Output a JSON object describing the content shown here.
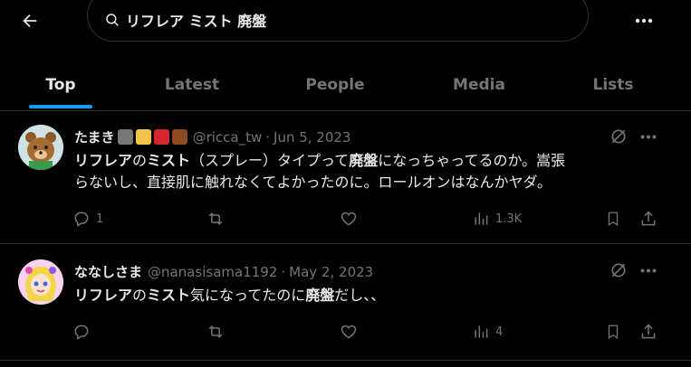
{
  "header": {
    "search_query": "リフレア ミスト 廃盤"
  },
  "tabs": [
    {
      "label": "Top"
    },
    {
      "label": "Latest"
    },
    {
      "label": "People"
    },
    {
      "label": "Media"
    },
    {
      "label": "Lists"
    }
  ],
  "tweets": [
    {
      "display_name": "たまき",
      "handle": "@ricca_tw",
      "separator": "·",
      "date": "Jun 5, 2023",
      "text_segments": [
        "リフレア",
        "の",
        "ミスト",
        "（スプレー）タイプって",
        "廃盤",
        "になっちゃってるのか。嵩張"
      ],
      "text_line2": "らないし、直接肌に触れなくてよかったのに。ロールオンはなんかヤダ。",
      "replies": "1",
      "retweets": "",
      "likes": "",
      "views": "1.3K"
    },
    {
      "display_name": "ななしさま",
      "handle": "@nanasisama1192",
      "separator": "·",
      "date": "May 2, 2023",
      "text_segments": [
        "リフレア",
        "の",
        "ミスト",
        "気になってたのに",
        "廃盤",
        "だし、、"
      ],
      "replies": "",
      "retweets": "",
      "likes": "",
      "views": "4"
    }
  ],
  "icons": {
    "back": "arrow-left-icon",
    "search": "search-icon",
    "more": "more-horizontal-icon",
    "grok": "grok-icon",
    "reply": "reply-icon",
    "retweet": "retweet-icon",
    "like": "heart-icon",
    "views": "views-icon",
    "bookmark": "bookmark-icon",
    "share": "share-icon"
  },
  "colors": {
    "background": "#000000",
    "accent": "#1d9bf0",
    "text_primary": "#e7e9ea",
    "text_secondary": "#71767b",
    "divider": "#2f3336"
  }
}
